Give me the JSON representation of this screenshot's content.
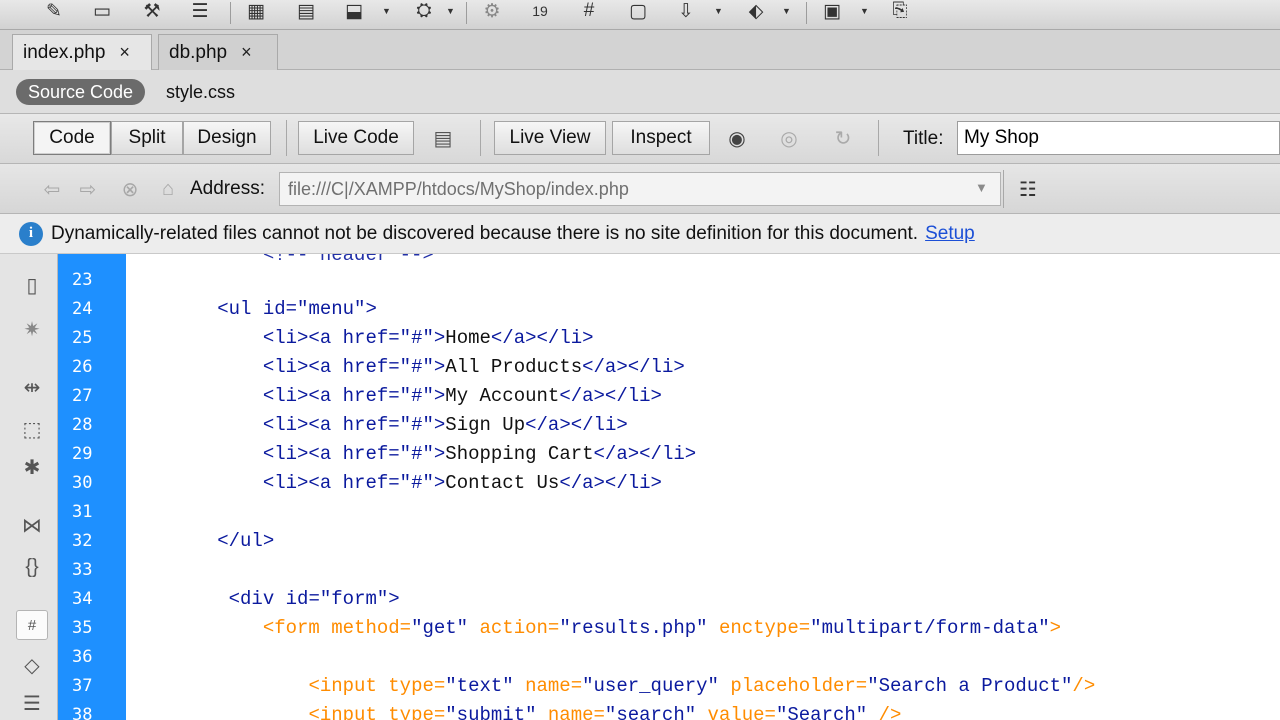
{
  "document_tabs": [
    {
      "label": "index.php",
      "close": "×",
      "active": true
    },
    {
      "label": "db.php",
      "close": "×",
      "active": false
    }
  ],
  "related_files": {
    "active": "Source Code",
    "items": [
      "style.css"
    ]
  },
  "view_toolbar": {
    "buttons": {
      "code": "Code",
      "split": "Split",
      "design": "Design",
      "live_code": "Live Code",
      "live_view": "Live View",
      "inspect": "Inspect"
    },
    "title_label": "Title:",
    "title_value": "My Shop"
  },
  "address_bar": {
    "label": "Address:",
    "value": "file:///C|/XAMPP/htdocs/MyShop/index.php"
  },
  "info_bar": {
    "message": "Dynamically-related files cannot not be discovered because there is no site definition for this document.",
    "link": "Setup"
  },
  "top_toolbar_icons": [
    "preview-icon",
    "new-document-icon",
    "insert-table-icon",
    "insert-menu-icon",
    "div-icon",
    "layout-icon",
    "media-icon",
    "image-icon",
    "widget-icon",
    "date-icon",
    "hash-icon",
    "comment-icon",
    "tag-icon",
    "snippet-icon",
    "template-icon",
    "library-icon"
  ],
  "code_lines": [
    {
      "num": "23",
      "indent": "            ",
      "parts": [
        {
          "cls": "t",
          "text": "<!-- header -->"
        }
      ],
      "partial": true
    },
    {
      "num": "24",
      "indent": "        ",
      "parts": [
        {
          "cls": "t",
          "text": "<ul "
        },
        {
          "cls": "a",
          "text": "id="
        },
        {
          "cls": "v",
          "text": "\"menu\""
        },
        {
          "cls": "t",
          "text": ">"
        }
      ]
    },
    {
      "num": "25",
      "indent": "            ",
      "parts": [
        {
          "cls": "t",
          "text": "<li><a "
        },
        {
          "cls": "a",
          "text": "href="
        },
        {
          "cls": "v",
          "text": "\"#\""
        },
        {
          "cls": "t",
          "text": ">"
        },
        {
          "cls": "txt",
          "text": "Home"
        },
        {
          "cls": "t",
          "text": "</a></li>"
        }
      ]
    },
    {
      "num": "26",
      "indent": "            ",
      "parts": [
        {
          "cls": "t",
          "text": "<li><a "
        },
        {
          "cls": "a",
          "text": "href="
        },
        {
          "cls": "v",
          "text": "\"#\""
        },
        {
          "cls": "t",
          "text": ">"
        },
        {
          "cls": "txt",
          "text": "All Products"
        },
        {
          "cls": "t",
          "text": "</a></li>"
        }
      ]
    },
    {
      "num": "27",
      "indent": "            ",
      "parts": [
        {
          "cls": "t",
          "text": "<li><a "
        },
        {
          "cls": "a",
          "text": "href="
        },
        {
          "cls": "v",
          "text": "\"#\""
        },
        {
          "cls": "t",
          "text": ">"
        },
        {
          "cls": "txt",
          "text": "My Account"
        },
        {
          "cls": "t",
          "text": "</a></li>"
        }
      ]
    },
    {
      "num": "28",
      "indent": "            ",
      "parts": [
        {
          "cls": "t",
          "text": "<li><a "
        },
        {
          "cls": "a",
          "text": "href="
        },
        {
          "cls": "v",
          "text": "\"#\""
        },
        {
          "cls": "t",
          "text": ">"
        },
        {
          "cls": "txt",
          "text": "Sign Up"
        },
        {
          "cls": "t",
          "text": "</a></li>"
        }
      ]
    },
    {
      "num": "29",
      "indent": "            ",
      "parts": [
        {
          "cls": "t",
          "text": "<li><a "
        },
        {
          "cls": "a",
          "text": "href="
        },
        {
          "cls": "v",
          "text": "\"#\""
        },
        {
          "cls": "t",
          "text": ">"
        },
        {
          "cls": "txt",
          "text": "Shopping Cart"
        },
        {
          "cls": "t",
          "text": "</a></li>"
        }
      ]
    },
    {
      "num": "30",
      "indent": "            ",
      "parts": [
        {
          "cls": "t",
          "text": "<li><a "
        },
        {
          "cls": "a",
          "text": "href="
        },
        {
          "cls": "v",
          "text": "\"#\""
        },
        {
          "cls": "t",
          "text": ">"
        },
        {
          "cls": "txt",
          "text": "Contact Us"
        },
        {
          "cls": "t",
          "text": "</a></li>"
        }
      ]
    },
    {
      "num": "31",
      "indent": "",
      "parts": []
    },
    {
      "num": "32",
      "indent": "        ",
      "parts": [
        {
          "cls": "t",
          "text": "</ul>"
        }
      ]
    },
    {
      "num": "33",
      "indent": "",
      "parts": []
    },
    {
      "num": "34",
      "indent": "         ",
      "parts": [
        {
          "cls": "t",
          "text": "<div "
        },
        {
          "cls": "a",
          "text": "id="
        },
        {
          "cls": "v",
          "text": "\"form\""
        },
        {
          "cls": "t",
          "text": ">"
        }
      ]
    },
    {
      "num": "35",
      "indent": "            ",
      "parts": [
        {
          "cls": "ft",
          "text": "<form "
        },
        {
          "cls": "ft",
          "text": "method="
        },
        {
          "cls": "fv",
          "text": "\"get\""
        },
        {
          "cls": "ft",
          "text": " action="
        },
        {
          "cls": "fv",
          "text": "\"results.php\""
        },
        {
          "cls": "ft",
          "text": " enctype="
        },
        {
          "cls": "fv",
          "text": "\"multipart/form-data\""
        },
        {
          "cls": "ft",
          "text": ">"
        }
      ]
    },
    {
      "num": "36",
      "indent": "",
      "parts": []
    },
    {
      "num": "37",
      "indent": "                ",
      "parts": [
        {
          "cls": "ft",
          "text": "<input "
        },
        {
          "cls": "ft",
          "text": "type="
        },
        {
          "cls": "fv",
          "text": "\"text\""
        },
        {
          "cls": "ft",
          "text": " name="
        },
        {
          "cls": "fv",
          "text": "\"user_query\""
        },
        {
          "cls": "ft",
          "text": " placeholder="
        },
        {
          "cls": "fv",
          "text": "\"Search a Product\""
        },
        {
          "cls": "ft",
          "text": "/>"
        }
      ]
    },
    {
      "num": "38",
      "indent": "                ",
      "parts": [
        {
          "cls": "ft",
          "text": "<input "
        },
        {
          "cls": "ft",
          "text": "type="
        },
        {
          "cls": "fv",
          "text": "\"submit\""
        },
        {
          "cls": "ft",
          "text": " name="
        },
        {
          "cls": "fv",
          "text": "\"search\""
        },
        {
          "cls": "ft",
          "text": " value="
        },
        {
          "cls": "fv",
          "text": "\"Search\""
        },
        {
          "cls": "ft",
          "text": " />"
        }
      ]
    }
  ],
  "side_toolbar_icons": [
    "open-documents-icon",
    "show-code-navigator-icon",
    "collapse-full-tag-icon",
    "collapse-selection-icon",
    "expand-all-icon",
    "select-parent-tag-icon",
    "balance-braces-icon",
    "line-numbers-icon",
    "highlight-invalid-code-icon",
    "apply-comment-icon"
  ],
  "colors": {
    "gutter": "#1e90ff",
    "tag": "#0b1a9e",
    "form_tag": "#ff8c00",
    "link": "#1b4fd6",
    "info_icon": "#2a7fcb"
  }
}
